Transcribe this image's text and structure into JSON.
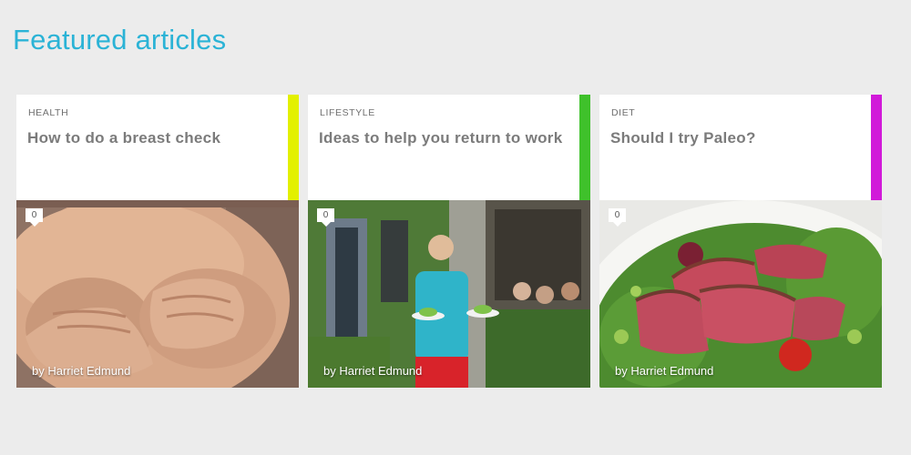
{
  "section": {
    "title": "Featured articles"
  },
  "colors": {
    "title": "#2bb3d6",
    "health_accent": "#e3f000",
    "lifestyle_accent": "#3fc12b",
    "diet_accent": "#d11ad9"
  },
  "articles": [
    {
      "category": "HEALTH",
      "title": "How to do a breast check",
      "comments": "0",
      "byline": "by Harriet Edmund",
      "accent": "#e3f000",
      "image_subject": "hands-on-chest-photo"
    },
    {
      "category": "LIFESTYLE",
      "title": "Ideas to help you return to work",
      "comments": "0",
      "byline": "by Harriet Edmund",
      "accent": "#3fc12b",
      "image_subject": "waiter-with-plates-photo"
    },
    {
      "category": "DIET",
      "title": "Should I try Paleo?",
      "comments": "0",
      "byline": "by Harriet Edmund",
      "accent": "#d11ad9",
      "image_subject": "steak-salad-photo"
    }
  ]
}
